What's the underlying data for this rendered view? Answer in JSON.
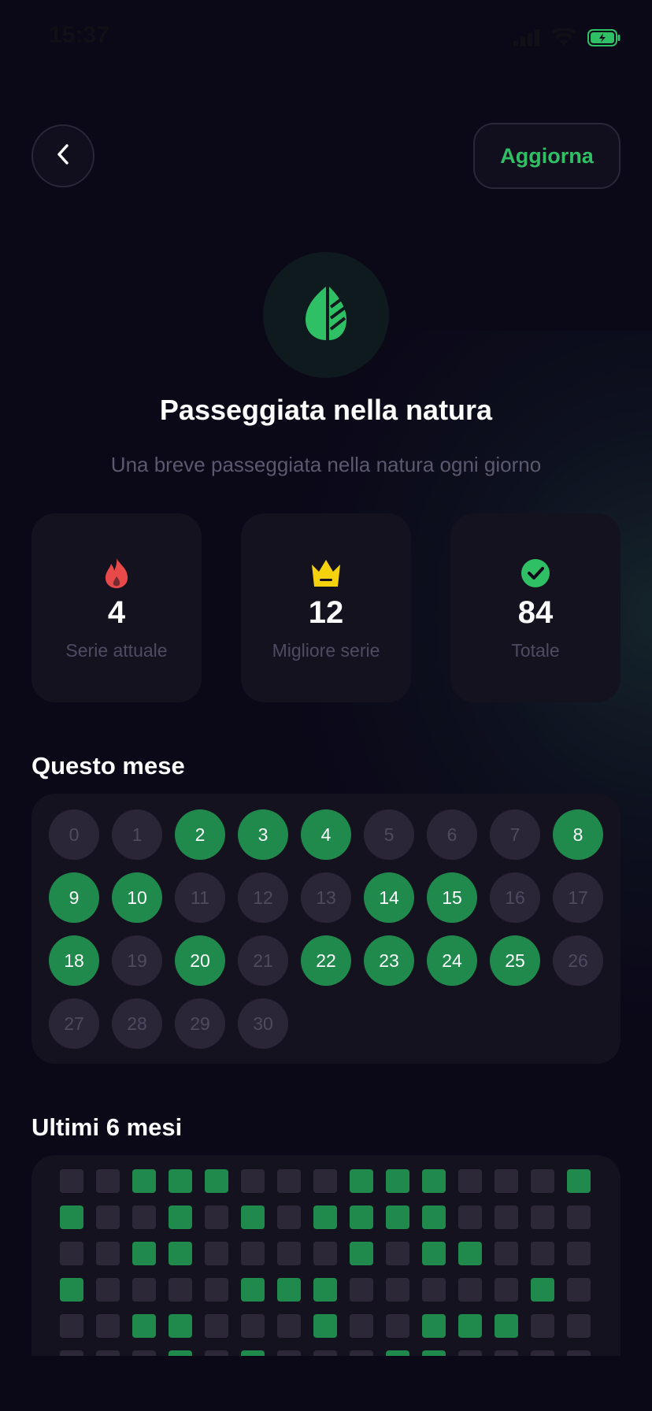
{
  "status_bar": {
    "time": "15:37"
  },
  "header": {
    "refresh_label": "Aggiorna"
  },
  "habit": {
    "icon": "leaf-icon",
    "title": "Passeggiata nella natura",
    "description": "Una breve passeggiata nella natura ogni giorno"
  },
  "stats": [
    {
      "icon": "flame-icon",
      "value": "4",
      "label": "Serie attuale"
    },
    {
      "icon": "crown-icon",
      "value": "12",
      "label": "Migliore serie"
    },
    {
      "icon": "check-circle-icon",
      "value": "84",
      "label": "Totale"
    }
  ],
  "this_month": {
    "title": "Questo mese",
    "days": [
      {
        "label": "0",
        "done": false
      },
      {
        "label": "1",
        "done": false
      },
      {
        "label": "2",
        "done": true
      },
      {
        "label": "3",
        "done": true
      },
      {
        "label": "4",
        "done": true
      },
      {
        "label": "5",
        "done": false
      },
      {
        "label": "6",
        "done": false
      },
      {
        "label": "7",
        "done": false
      },
      {
        "label": "8",
        "done": true
      },
      {
        "label": "9",
        "done": true
      },
      {
        "label": "10",
        "done": true
      },
      {
        "label": "11",
        "done": false
      },
      {
        "label": "12",
        "done": false
      },
      {
        "label": "13",
        "done": false
      },
      {
        "label": "14",
        "done": true
      },
      {
        "label": "15",
        "done": true
      },
      {
        "label": "16",
        "done": false
      },
      {
        "label": "17",
        "done": false
      },
      {
        "label": "18",
        "done": true
      },
      {
        "label": "19",
        "done": false
      },
      {
        "label": "20",
        "done": true
      },
      {
        "label": "21",
        "done": false
      },
      {
        "label": "22",
        "done": true
      },
      {
        "label": "23",
        "done": true
      },
      {
        "label": "24",
        "done": true
      },
      {
        "label": "25",
        "done": true
      },
      {
        "label": "26",
        "done": false
      },
      {
        "label": "27",
        "done": false
      },
      {
        "label": "28",
        "done": false
      },
      {
        "label": "29",
        "done": false
      },
      {
        "label": "30",
        "done": false
      }
    ]
  },
  "last_six_months": {
    "title": "Ultimi 6 mesi",
    "grid": [
      [
        0,
        0,
        1,
        1,
        1,
        0,
        0,
        0,
        1,
        1,
        1,
        0,
        0,
        0,
        1
      ],
      [
        1,
        0,
        0,
        1,
        0,
        1,
        0,
        1,
        1,
        1,
        1,
        0,
        0,
        0,
        0
      ],
      [
        0,
        0,
        1,
        1,
        0,
        0,
        0,
        0,
        1,
        0,
        1,
        1,
        0,
        0,
        0
      ],
      [
        1,
        0,
        0,
        0,
        0,
        1,
        1,
        1,
        0,
        0,
        0,
        0,
        0,
        1,
        0
      ],
      [
        0,
        0,
        1,
        1,
        0,
        0,
        0,
        1,
        0,
        0,
        1,
        1,
        1,
        0,
        0
      ],
      [
        0,
        0,
        0,
        1,
        0,
        1,
        0,
        0,
        0,
        1,
        1,
        0,
        0,
        0,
        0
      ]
    ]
  },
  "colors": {
    "accent_green": "#2fbf64",
    "done_green": "#1f8a4c",
    "flame_red": "#e84a4a",
    "crown_yellow": "#f5d20c",
    "background": "#0b0818",
    "card": "#15121f"
  }
}
